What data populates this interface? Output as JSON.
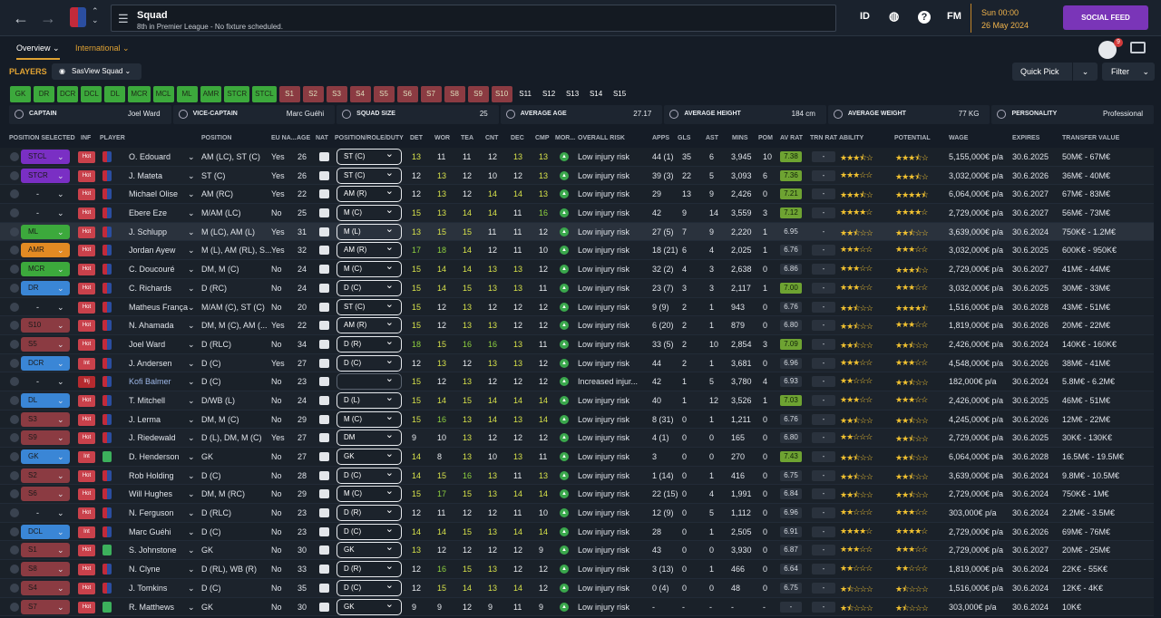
{
  "header": {
    "title": "Squad",
    "subtitle": "8th in Premier League - No fixture scheduled.",
    "time": "Sun 00:00",
    "day": "26 May 2024",
    "social_label": "SOCIAL FEED",
    "notif_count": "9",
    "icons": [
      "id-icon",
      "ball-icon",
      "help-icon",
      "fm-icon"
    ]
  },
  "subnav": {
    "overview": "Overview ⌄",
    "international": "International ⌄"
  },
  "players_bar": {
    "label": "PLAYERS",
    "view": "SasView Squad ⌄",
    "quick_pick": "Quick Pick",
    "filter": "Filter"
  },
  "position_buttons": [
    {
      "l": "GK",
      "s": "green"
    },
    {
      "l": "DR",
      "s": "green"
    },
    {
      "l": "DCR",
      "s": "green"
    },
    {
      "l": "DCL",
      "s": "green"
    },
    {
      "l": "DL",
      "s": "green"
    },
    {
      "l": "MCR",
      "s": "green"
    },
    {
      "l": "MCL",
      "s": "green"
    },
    {
      "l": "ML",
      "s": "green"
    },
    {
      "l": "AMR",
      "s": "green"
    },
    {
      "l": "STCR",
      "s": "green"
    },
    {
      "l": "STCL",
      "s": "green"
    },
    {
      "l": "S1",
      "s": "red"
    },
    {
      "l": "S2",
      "s": "red"
    },
    {
      "l": "S3",
      "s": "red"
    },
    {
      "l": "S4",
      "s": "red"
    },
    {
      "l": "S5",
      "s": "red"
    },
    {
      "l": "S6",
      "s": "red"
    },
    {
      "l": "S7",
      "s": "red"
    },
    {
      "l": "S8",
      "s": "red"
    },
    {
      "l": "S9",
      "s": "red"
    },
    {
      "l": "S10",
      "s": "red"
    },
    {
      "l": "S11",
      "s": "plain"
    },
    {
      "l": "S12",
      "s": "plain"
    },
    {
      "l": "S13",
      "s": "plain"
    },
    {
      "l": "S14",
      "s": "plain"
    },
    {
      "l": "S15",
      "s": "plain"
    }
  ],
  "info": [
    {
      "label": "CAPTAIN",
      "value": "Joel Ward"
    },
    {
      "label": "VICE-CAPTAIN",
      "value": "Marc Guéhi"
    },
    {
      "label": "SQUAD SIZE",
      "value": "25"
    },
    {
      "label": "AVERAGE AGE",
      "value": "27.17"
    },
    {
      "label": "AVERAGE HEIGHT",
      "value": "184 cm"
    },
    {
      "label": "AVERAGE WEIGHT",
      "value": "77 KG"
    },
    {
      "label": "PERSONALITY",
      "value": "Professional"
    }
  ],
  "columns": [
    "POSITION SELECTED",
    "INF",
    "PLAYER",
    "POSITION",
    "EU NA...",
    "AGE",
    "NAT",
    "POSITION/ROLE/DUTY",
    "DET",
    "WOR",
    "TEA",
    "CNT",
    "DEC",
    "CMP",
    "MOR...",
    "OVERALL RISK",
    "APPS",
    "GLS",
    "AST",
    "MINS",
    "POM",
    "AV RAT",
    "TRN RAT",
    "ABILITY",
    "POTENTIAL",
    "WAGE",
    "EXPIRES",
    "TRANSFER VALUE"
  ],
  "players": [
    [
      "STCL",
      "#7a2fc4",
      "Hot",
      "O. Edouard",
      "AM (LC), ST (C)",
      "Yes",
      "26",
      "ST (C)",
      "13",
      "11",
      "11",
      "12",
      "13",
      "13",
      "Low injury risk",
      "44 (1)",
      "35",
      "6",
      "3,945",
      "10",
      "7.38",
      "-",
      "3.5",
      "3.5",
      "5,155,000€ p/a",
      "30.6.2025",
      "50M€ - 67M€"
    ],
    [
      "STCR",
      "#7a2fc4",
      "Hot",
      "J. Mateta",
      "ST (C)",
      "Yes",
      "26",
      "ST (C)",
      "12",
      "13",
      "12",
      "10",
      "12",
      "13",
      "Low injury risk",
      "39 (3)",
      "22",
      "5",
      "3,093",
      "6",
      "7.36",
      "-",
      "3",
      "3.5",
      "3,032,000€ p/a",
      "30.6.2026",
      "36M€ - 40M€"
    ],
    [
      "-",
      "",
      "Hot",
      "Michael Olise",
      "AM (RC)",
      "Yes",
      "22",
      "AM (R)",
      "12",
      "13",
      "12",
      "14",
      "14",
      "13",
      "Low injury risk",
      "29",
      "13",
      "9",
      "2,426",
      "0",
      "7.21",
      "-",
      "3.5",
      "4.5",
      "6,064,000€ p/a",
      "30.6.2027",
      "67M€ - 83M€"
    ],
    [
      "-",
      "",
      "Hot",
      "Ebere Eze",
      "M/AM (LC)",
      "No",
      "25",
      "M (C)",
      "15",
      "13",
      "14",
      "14",
      "11",
      "16",
      "Low injury risk",
      "42",
      "9",
      "14",
      "3,559",
      "3",
      "7.12",
      "-",
      "4",
      "4",
      "2,729,000€ p/a",
      "30.6.2027",
      "56M€ - 73M€"
    ],
    [
      "ML",
      "#3ca93c",
      "Hot",
      "J. Schlupp",
      "M (LC), AM (L)",
      "Yes",
      "31",
      "M (L)",
      "13",
      "15",
      "15",
      "11",
      "11",
      "12",
      "Low injury risk",
      "27 (5)",
      "7",
      "9",
      "2,220",
      "1",
      "6.95",
      "-",
      "2.5",
      "2.5",
      "3,639,000€ p/a",
      "30.6.2024",
      "750K€ - 1.2M€"
    ],
    [
      "AMR",
      "#e28a23",
      "Hot",
      "Jordan Ayew",
      "M (L), AM (RL), S...",
      "Yes",
      "32",
      "AM (R)",
      "17",
      "18",
      "14",
      "12",
      "11",
      "10",
      "Low injury risk",
      "18 (21)",
      "6",
      "4",
      "2,025",
      "1",
      "6.76",
      "-",
      "3",
      "3",
      "3,032,000€ p/a",
      "30.6.2025",
      "600K€ - 950K€"
    ],
    [
      "MCR",
      "#3ca93c",
      "Hot",
      "C. Doucouré",
      "DM, M (C)",
      "No",
      "24",
      "M (C)",
      "15",
      "14",
      "14",
      "13",
      "13",
      "12",
      "Low injury risk",
      "32 (2)",
      "4",
      "3",
      "2,638",
      "0",
      "6.86",
      "-",
      "3",
      "3.5",
      "2,729,000€ p/a",
      "30.6.2027",
      "41M€ - 44M€"
    ],
    [
      "DR",
      "#3a86d6",
      "Hot",
      "C. Richards",
      "D (RC)",
      "No",
      "24",
      "D (C)",
      "15",
      "14",
      "15",
      "13",
      "13",
      "11",
      "Low injury risk",
      "23 (7)",
      "3",
      "3",
      "2,117",
      "1",
      "7.00",
      "-",
      "3",
      "3",
      "3,032,000€ p/a",
      "30.6.2025",
      "30M€ - 33M€"
    ],
    [
      "-",
      "",
      "Hot",
      "Matheus França",
      "M/AM (C), ST (C)",
      "No",
      "20",
      "ST (C)",
      "15",
      "12",
      "13",
      "12",
      "12",
      "12",
      "Low injury risk",
      "9 (9)",
      "2",
      "1",
      "943",
      "0",
      "6.76",
      "-",
      "2.5",
      "4.5",
      "1,516,000€ p/a",
      "30.6.2028",
      "43M€ - 51M€"
    ],
    [
      "S10",
      "#8b3b42",
      "Hot",
      "N. Ahamada",
      "DM, M (C), AM (...",
      "Yes",
      "22",
      "AM (R)",
      "15",
      "12",
      "13",
      "13",
      "12",
      "12",
      "Low injury risk",
      "6 (20)",
      "2",
      "1",
      "879",
      "0",
      "6.80",
      "-",
      "2.5",
      "3",
      "1,819,000€ p/a",
      "30.6.2026",
      "20M€ - 22M€"
    ],
    [
      "S5",
      "#8b3b42",
      "Hot",
      "Joel Ward",
      "D (RLC)",
      "No",
      "34",
      "D (R)",
      "18",
      "15",
      "16",
      "16",
      "13",
      "11",
      "Low injury risk",
      "33 (5)",
      "2",
      "10",
      "2,854",
      "3",
      "7.09",
      "-",
      "2.5",
      "2.5",
      "2,426,000€ p/a",
      "30.6.2024",
      "140K€ - 160K€"
    ],
    [
      "DCR",
      "#3a86d6",
      "Int",
      "J. Andersen",
      "D (C)",
      "Yes",
      "27",
      "D (C)",
      "12",
      "13",
      "12",
      "13",
      "13",
      "12",
      "Low injury risk",
      "44",
      "2",
      "1",
      "3,681",
      "0",
      "6.96",
      "-",
      "3",
      "3",
      "4,548,000€ p/a",
      "30.6.2026",
      "38M€ - 41M€"
    ],
    [
      "-",
      "",
      "Inj",
      "Kofi Balmer",
      "D (C)",
      "No",
      "23",
      "",
      "15",
      "12",
      "13",
      "12",
      "12",
      "12",
      "Increased injur...",
      "42",
      "1",
      "5",
      "3,780",
      "4",
      "6.93",
      "-",
      "2",
      "2.5",
      "182,000€ p/a",
      "30.6.2024",
      "5.8M€ - 6.2M€"
    ],
    [
      "DL",
      "#3a86d6",
      "Hot",
      "T. Mitchell",
      "D/WB (L)",
      "No",
      "24",
      "D (L)",
      "15",
      "14",
      "15",
      "14",
      "14",
      "14",
      "Low injury risk",
      "40",
      "1",
      "12",
      "3,526",
      "1",
      "7.03",
      "-",
      "3",
      "3",
      "2,426,000€ p/a",
      "30.6.2025",
      "46M€ - 51M€"
    ],
    [
      "S3",
      "#8b3b42",
      "Hot",
      "J. Lerma",
      "DM, M (C)",
      "No",
      "29",
      "M (C)",
      "15",
      "16",
      "13",
      "14",
      "13",
      "14",
      "Low injury risk",
      "8 (31)",
      "0",
      "1",
      "1,211",
      "0",
      "6.76",
      "-",
      "2.5",
      "2.5",
      "4,245,000€ p/a",
      "30.6.2026",
      "12M€ - 22M€"
    ],
    [
      "S9",
      "#8b3b42",
      "Hot",
      "J. Riedewald",
      "D (L), DM, M (C)",
      "Yes",
      "27",
      "DM",
      "9",
      "10",
      "13",
      "12",
      "12",
      "12",
      "Low injury risk",
      "4 (1)",
      "0",
      "0",
      "165",
      "0",
      "6.80",
      "-",
      "2",
      "2.5",
      "2,729,000€ p/a",
      "30.6.2025",
      "30K€ - 130K€"
    ],
    [
      "GK",
      "#3a86d6",
      "Int",
      "D. Henderson",
      "GK",
      "No",
      "27",
      "GK",
      "14",
      "8",
      "13",
      "10",
      "13",
      "11",
      "Low injury risk",
      "3",
      "0",
      "0",
      "270",
      "0",
      "7.43",
      "-",
      "2.5",
      "2.5",
      "6,064,000€ p/a",
      "30.6.2028",
      "16.5M€ - 19.5M€"
    ],
    [
      "S2",
      "#8b3b42",
      "Hot",
      "Rob Holding",
      "D (C)",
      "No",
      "28",
      "D (C)",
      "14",
      "15",
      "16",
      "13",
      "11",
      "13",
      "Low injury risk",
      "1 (14)",
      "0",
      "1",
      "416",
      "0",
      "6.75",
      "-",
      "2.5",
      "2.5",
      "3,639,000€ p/a",
      "30.6.2024",
      "9.8M€ - 10.5M€"
    ],
    [
      "S6",
      "#8b3b42",
      "Hot",
      "Will Hughes",
      "DM, M (RC)",
      "No",
      "29",
      "M (C)",
      "15",
      "17",
      "15",
      "13",
      "14",
      "14",
      "Low injury risk",
      "22 (15)",
      "0",
      "4",
      "1,991",
      "0",
      "6.84",
      "-",
      "2.5",
      "2.5",
      "2,729,000€ p/a",
      "30.6.2024",
      "750K€ - 1M€"
    ],
    [
      "-",
      "",
      "Hot",
      "N. Ferguson",
      "D (RLC)",
      "No",
      "23",
      "D (R)",
      "12",
      "11",
      "12",
      "12",
      "11",
      "10",
      "Low injury risk",
      "12 (9)",
      "0",
      "5",
      "1,112",
      "0",
      "6.96",
      "-",
      "2",
      "3",
      "303,000€ p/a",
      "30.6.2024",
      "2.2M€ - 3.5M€"
    ],
    [
      "DCL",
      "#3a86d6",
      "Int",
      "Marc Guéhi",
      "D (C)",
      "No",
      "23",
      "D (C)",
      "14",
      "14",
      "15",
      "13",
      "14",
      "14",
      "Low injury risk",
      "28",
      "0",
      "1",
      "2,505",
      "0",
      "6.91",
      "-",
      "4",
      "4",
      "2,729,000€ p/a",
      "30.6.2026",
      "69M€ - 76M€"
    ],
    [
      "S1",
      "#8b3b42",
      "Hot",
      "S. Johnstone",
      "GK",
      "No",
      "30",
      "GK",
      "13",
      "12",
      "12",
      "12",
      "12",
      "9",
      "Low injury risk",
      "43",
      "0",
      "0",
      "3,930",
      "0",
      "6.87",
      "-",
      "3",
      "3",
      "2,729,000€ p/a",
      "30.6.2027",
      "20M€ - 25M€"
    ],
    [
      "S8",
      "#8b3b42",
      "Hot",
      "N. Clyne",
      "D (RL), WB (R)",
      "No",
      "33",
      "D (R)",
      "12",
      "16",
      "15",
      "13",
      "12",
      "12",
      "Low injury risk",
      "3 (13)",
      "0",
      "1",
      "466",
      "0",
      "6.64",
      "-",
      "2",
      "2",
      "1,819,000€ p/a",
      "30.6.2024",
      "22K€ - 55K€"
    ],
    [
      "S4",
      "#8b3b42",
      "Hot",
      "J. Tomkins",
      "D (C)",
      "No",
      "35",
      "D (C)",
      "12",
      "15",
      "14",
      "13",
      "14",
      "12",
      "Low injury risk",
      "0 (4)",
      "0",
      "0",
      "48",
      "0",
      "6.75",
      "-",
      "1.5",
      "1.5",
      "1,516,000€ p/a",
      "30.6.2024",
      "12K€ - 4K€"
    ],
    [
      "S7",
      "#8b3b42",
      "Hot",
      "R. Matthews",
      "GK",
      "No",
      "30",
      "GK",
      "9",
      "9",
      "12",
      "9",
      "11",
      "9",
      "Low injury risk",
      "-",
      "-",
      "-",
      "-",
      "-",
      "-",
      "-",
      "1.5",
      "1.5",
      "303,000€ p/a",
      "30.6.2024",
      "10K€"
    ]
  ]
}
